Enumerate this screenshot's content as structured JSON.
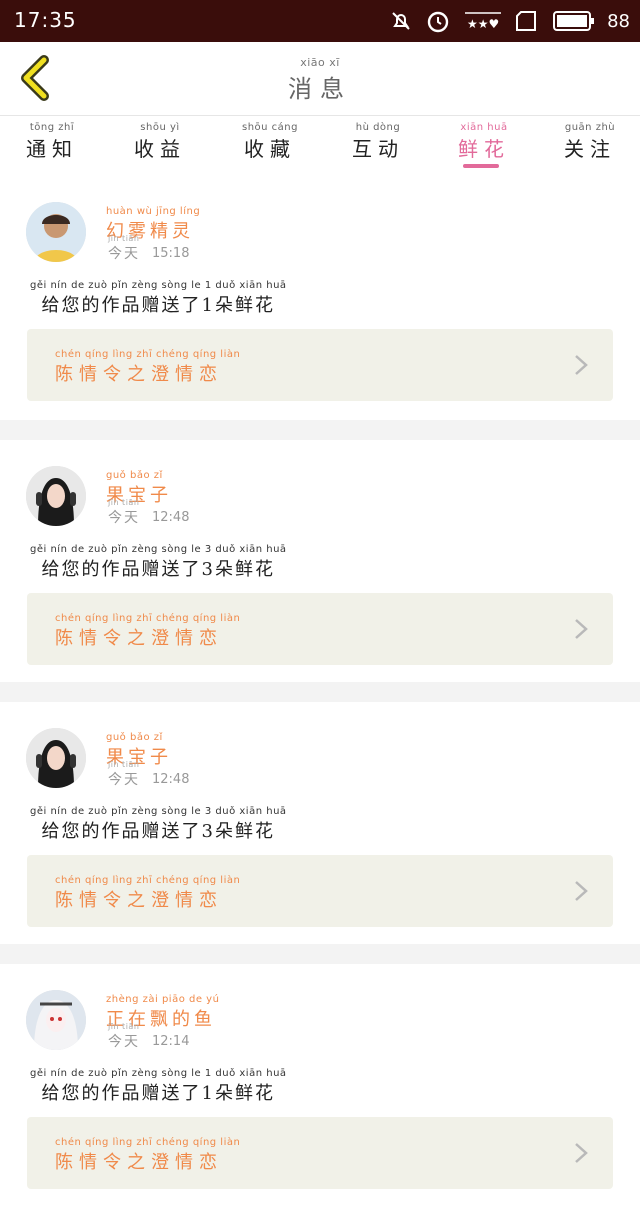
{
  "status": {
    "time": "17:35",
    "battery": "88"
  },
  "header": {
    "title_pinyin": "xiāo  xī",
    "title": "消息"
  },
  "tabs": [
    {
      "pinyin": "tōng  zhī",
      "label": "通知"
    },
    {
      "pinyin": "shōu  yì",
      "label": "收益"
    },
    {
      "pinyin": "shōu cáng",
      "label": "收藏"
    },
    {
      "pinyin": "hù  dòng",
      "label": "互动"
    },
    {
      "pinyin": "xiān  huā",
      "label": "鲜花",
      "active": true
    },
    {
      "pinyin": "guān  zhù",
      "label": "关注"
    }
  ],
  "items": [
    {
      "name_pinyin": "huàn wù jīng líng",
      "name": "幻雾精灵",
      "date_pinyin": "jīn tiān",
      "date": "今天",
      "time": "15:18",
      "msg_pinyin": "gěi nín de zuò pǐn zèng sòng le 1 duǒ xiān huā",
      "message": "给您的作品赠送了1朵鲜花",
      "work_pinyin": "chén qíng lìng zhī chéng qíng liàn",
      "work": "陈情令之澄情恋"
    },
    {
      "name_pinyin": "guǒ bǎo zǐ",
      "name": "果宝子",
      "date_pinyin": "jīn tiān",
      "date": "今天",
      "time": "12:48",
      "msg_pinyin": "gěi nín de zuò pǐn zèng sòng le 3 duǒ xiān huā",
      "message": "给您的作品赠送了3朵鲜花",
      "work_pinyin": "chén qíng lìng zhī chéng qíng liàn",
      "work": "陈情令之澄情恋"
    },
    {
      "name_pinyin": "guǒ bǎo zǐ",
      "name": "果宝子",
      "date_pinyin": "jīn tiān",
      "date": "今天",
      "time": "12:48",
      "msg_pinyin": "gěi nín de zuò pǐn zèng sòng le 3 duǒ xiān huā",
      "message": "给您的作品赠送了3朵鲜花",
      "work_pinyin": "chén qíng lìng zhī chéng qíng liàn",
      "work": "陈情令之澄情恋"
    },
    {
      "name_pinyin": "zhèng zài piāo de yú",
      "name": "正在飘的鱼",
      "date_pinyin": "jīn tiān",
      "date": "今天",
      "time": "12:14",
      "msg_pinyin": "gěi nín de zuò pǐn zèng sòng le 1 duǒ xiān huā",
      "message": "给您的作品赠送了1朵鲜花",
      "work_pinyin": "chén qíng lìng zhī chéng qíng liàn",
      "work": "陈情令之澄情恋"
    }
  ],
  "colors": {
    "statusbar": "#3a0d0b",
    "accent": "#e26a9a",
    "name": "#f08a4a",
    "workbox": "#f1f1e8",
    "back": "#f0e020"
  },
  "icons": [
    "mute-icon",
    "alarm-icon",
    "notification-icon",
    "sim-icon",
    "battery-icon",
    "back-chevron-icon",
    "chevron-right-icon"
  ]
}
